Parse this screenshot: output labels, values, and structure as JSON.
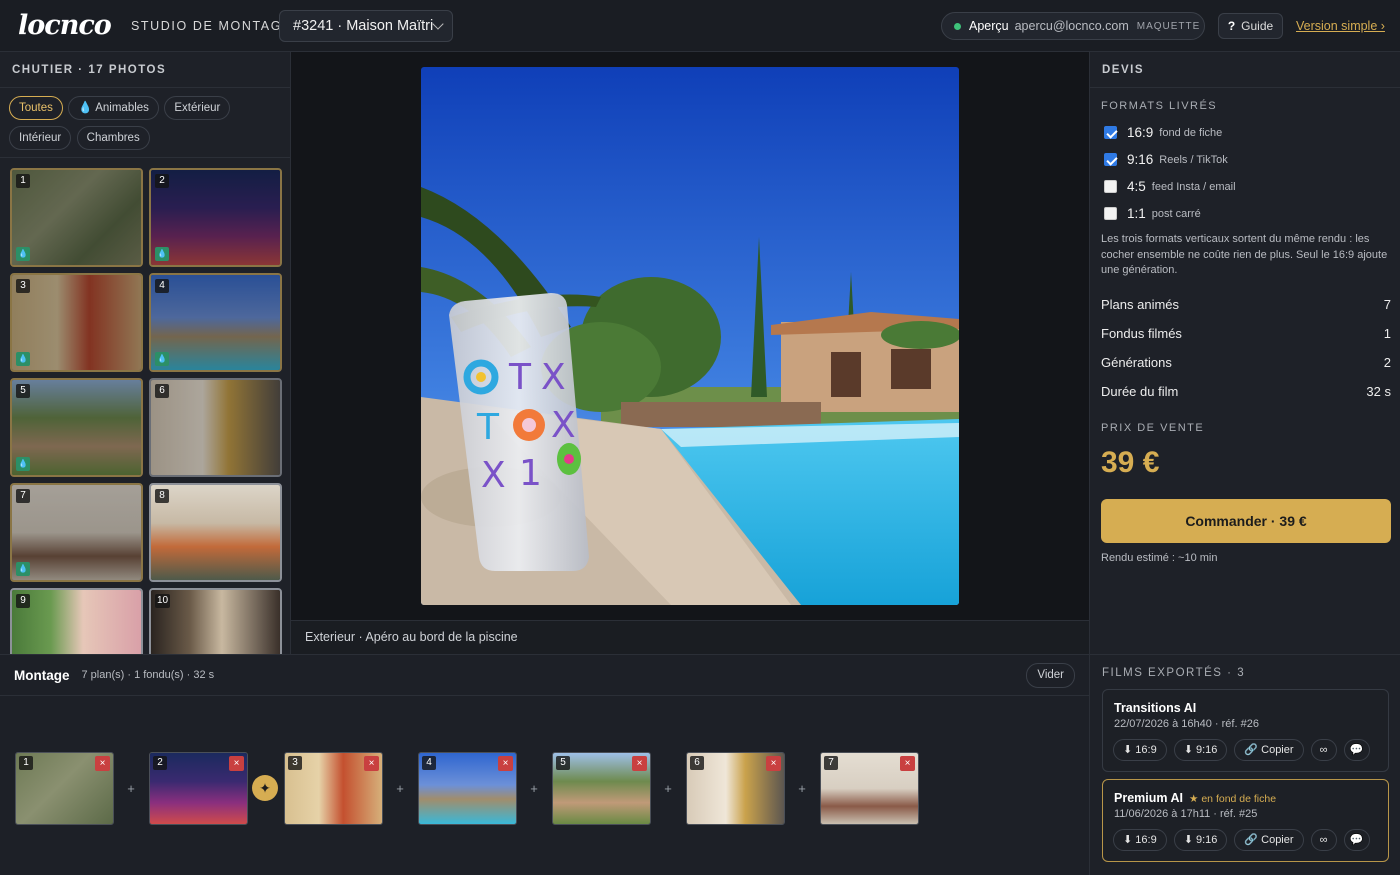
{
  "header": {
    "logo": "locnco",
    "studio_label": "STUDIO DE MONTAGE",
    "project": "#3241 · Maison Maïtri",
    "preview_label": "Aperçu",
    "preview_email": "apercu@locnco.com",
    "preview_badge": "MAQUETTE",
    "guide_icon": "?",
    "guide_label": "Guide",
    "simple_link": "Version simple ›"
  },
  "chutier": {
    "title": "CHUTIER · 17 PHOTOS",
    "filters": [
      "Toutes",
      "💧 Animables",
      "Extérieur",
      "Intérieur",
      "Chambres"
    ],
    "active_filter": "Toutes",
    "photos": [
      {
        "n": "1",
        "animable": true
      },
      {
        "n": "2",
        "animable": true
      },
      {
        "n": "3",
        "animable": true
      },
      {
        "n": "4",
        "animable": true
      },
      {
        "n": "5",
        "animable": true
      },
      {
        "n": "6",
        "animable": false
      },
      {
        "n": "7",
        "animable": true
      },
      {
        "n": "8",
        "animable": false
      },
      {
        "n": "9",
        "animable": false
      },
      {
        "n": "10",
        "animable": false
      }
    ]
  },
  "viewer": {
    "caption": "Exterieur · Apéro au bord de la piscine",
    "glass_text": "TX TOX X1"
  },
  "devis": {
    "title": "DEVIS",
    "formats_title": "FORMATS LIVRÉS",
    "formats": [
      {
        "ratio": "16:9",
        "desc": "fond de fiche",
        "checked": true
      },
      {
        "ratio": "9:16",
        "desc": "Reels / TikTok",
        "checked": true
      },
      {
        "ratio": "4:5",
        "desc": "feed Insta / email",
        "checked": false
      },
      {
        "ratio": "1:1",
        "desc": "post carré",
        "checked": false
      }
    ],
    "note": "Les trois formats verticaux sortent du même rendu : les cocher ensemble ne coûte rien de plus. Seul le 16:9 ajoute une génération.",
    "stats": [
      {
        "label": "Plans animés",
        "value": "7"
      },
      {
        "label": "Fondus filmés",
        "value": "1"
      },
      {
        "label": "Générations",
        "value": "2"
      },
      {
        "label": "Durée du film",
        "value": "32 s"
      }
    ],
    "price_title": "PRIX DE VENTE",
    "price": "39 €",
    "order_button": "Commander · 39 €",
    "estimate": "Rendu estimé : ~10 min"
  },
  "montage": {
    "title": "Montage",
    "summary": "7 plan(s) · 1 fondu(s) · 32 s",
    "clear_button": "Vider",
    "shots": [
      "1",
      "2",
      "3",
      "4",
      "5",
      "6",
      "7"
    ],
    "plus_symbol": "+",
    "fade_symbol": "✦",
    "delete_symbol": "×"
  },
  "films": {
    "title": "FILMS EXPORTÉS · 3",
    "items": [
      {
        "name": "Transitions AI",
        "tag": "",
        "meta": "22/07/2026 à 16h40 · réf. #26",
        "b1": "⬇ 16:9",
        "b2": "⬇ 9:16",
        "b3": "🔗 Copier",
        "b4": "∞",
        "b5": "💬"
      },
      {
        "name": "Premium AI",
        "tag": "★ en fond de fiche",
        "meta": "11/06/2026 à 17h11 · réf. #25",
        "b1": "⬇ 16:9",
        "b2": "⬇ 9:16",
        "b3": "🔗 Copier",
        "b4": "∞",
        "b5": "💬"
      }
    ]
  },
  "colors": {
    "accent": "#d6ad52",
    "bg": "#1d2027",
    "check": "#2f7ae5",
    "danger": "#c94040"
  }
}
